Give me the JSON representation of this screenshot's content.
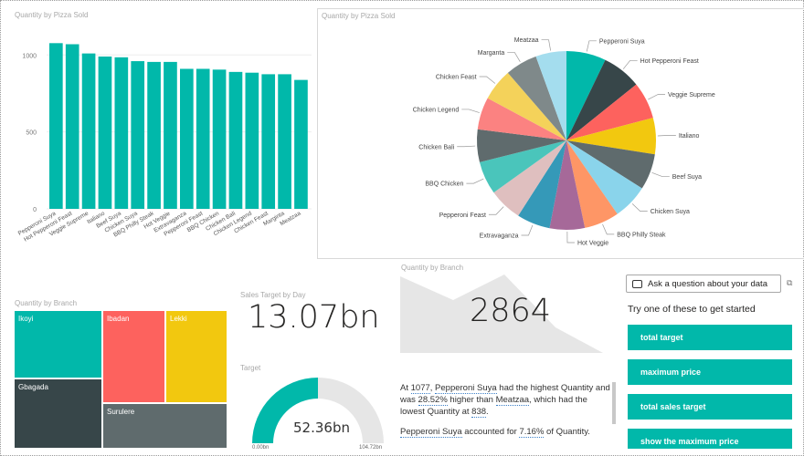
{
  "bar_visual": {
    "title": "Quantity by Pizza Sold",
    "bar_color": "#01b8aa"
  },
  "pie_visual": {
    "title": "Quantity by Pizza Sold"
  },
  "treemap_visual": {
    "title": "Quantity by Branch",
    "tiles": [
      {
        "label": "Ikoyi",
        "color": "#01b8aa"
      },
      {
        "label": "Gbagada",
        "color": "#374649"
      },
      {
        "label": "Ibadan",
        "color": "#fd625e"
      },
      {
        "label": "Lekki",
        "color": "#f2c80f"
      },
      {
        "label": "Surulere",
        "color": "#5f6b6d"
      }
    ]
  },
  "sales_card": {
    "title": "Sales Target by Day",
    "value": "13.07bn"
  },
  "gauge_visual": {
    "title": "Target",
    "value": "52.36bn",
    "min_label": "0.00bn",
    "max_label": "104.72bn",
    "fill_fraction": 0.5,
    "fill_color": "#01b8aa",
    "track_color": "#e6e6e6"
  },
  "branch_card": {
    "title": "Quantity by Branch",
    "value": "2864",
    "area_color": "#e6e6e6"
  },
  "narrative": {
    "p1_a": "At ",
    "p1_v1": "1077",
    "p1_b": ", ",
    "p1_v2": "Pepperoni Suya",
    "p1_c": " had the highest Quantity and was ",
    "p1_v3": "28.52%",
    "p1_d": " higher than ",
    "p1_v4": "Meatzaa",
    "p1_e": ", which had the lowest Quantity at ",
    "p1_v5": "838",
    "p1_f": ".",
    "p2_v1": "Pepperoni Suya",
    "p2_a": " accounted for ",
    "p2_v2": "7.16%",
    "p2_b": " of Quantity."
  },
  "qa": {
    "placeholder": "Ask a question about your data",
    "intro": "Try one of these to get started",
    "suggestions": [
      "total target",
      "maximum price",
      "total sales target",
      "show the maximum price"
    ]
  },
  "chart_data": [
    {
      "type": "bar",
      "title": "Quantity by Pizza Sold",
      "categories": [
        "Pepperoni Suya",
        "Hot Pepperoni Feast",
        "Veggie Supreme",
        "Italiano",
        "Beef Suya",
        "Chicken Suya",
        "BBQ Philly Steak",
        "Hot Veggie",
        "Extravaganza",
        "Pepperoni Feast",
        "BBQ Chicken",
        "Chicken Bali",
        "Chicken Legend",
        "Chicken Feast",
        "Marginta",
        "Meatzaa"
      ],
      "values": [
        1077,
        1070,
        1010,
        990,
        985,
        960,
        955,
        955,
        910,
        910,
        905,
        890,
        885,
        875,
        875,
        838
      ],
      "yticks": [
        "0",
        "500",
        "1000"
      ],
      "ylim": [
        0,
        1150
      ]
    },
    {
      "type": "pie",
      "title": "Quantity by Pizza Sold",
      "slices": [
        {
          "label": "Pepperoni Suya",
          "value": 1077,
          "color": "#01b8aa"
        },
        {
          "label": "Hot Pepperoni Feast",
          "value": 1070,
          "color": "#374649"
        },
        {
          "label": "Veggie Supreme",
          "value": 1010,
          "color": "#fd625e"
        },
        {
          "label": "Italiano",
          "value": 990,
          "color": "#f2c80f"
        },
        {
          "label": "Beef Suya",
          "value": 985,
          "color": "#5f6b6d"
        },
        {
          "label": "Chicken Suya",
          "value": 960,
          "color": "#8ad4eb"
        },
        {
          "label": "BBQ Philly Steak",
          "value": 955,
          "color": "#fe9666"
        },
        {
          "label": "Hot Veggie",
          "value": 955,
          "color": "#a66999"
        },
        {
          "label": "Extravaganza",
          "value": 910,
          "color": "#3599b8"
        },
        {
          "label": "Pepperoni Feast",
          "value": 910,
          "color": "#dfbfbf"
        },
        {
          "label": "BBQ Chicken",
          "value": 905,
          "color": "#4ac5bb"
        },
        {
          "label": "Chicken Bali",
          "value": 890,
          "color": "#5f6b6d"
        },
        {
          "label": "Chicken Legend",
          "value": 885,
          "color": "#fb8281"
        },
        {
          "label": "Chicken Feast",
          "value": 875,
          "color": "#f4d25a"
        },
        {
          "label": "Marganta",
          "value": 875,
          "color": "#7f898a"
        },
        {
          "label": "Meatzaa",
          "value": 838,
          "color": "#a4ddee"
        }
      ]
    }
  ]
}
